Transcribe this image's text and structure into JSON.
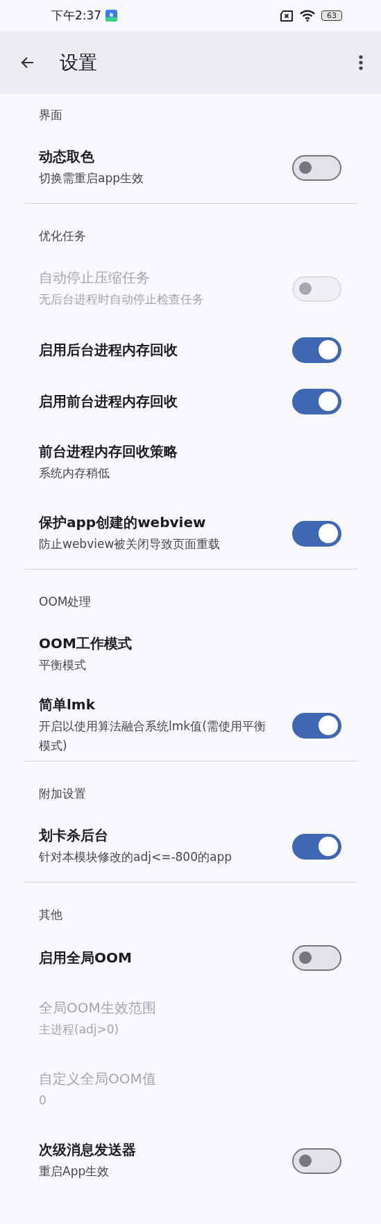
{
  "status_bar": {
    "time": "下午2:37",
    "battery": "63"
  },
  "app_bar": {
    "title": "设置"
  },
  "sections": [
    {
      "title": "界面",
      "items": [
        {
          "kind": "switch",
          "title": "动态取色",
          "subtitle": "切换需重启app生效",
          "on": false,
          "disabled": false
        }
      ]
    },
    {
      "title": "优化任务",
      "items": [
        {
          "kind": "switch",
          "title": "自动停止压缩任务",
          "subtitle": "无后台进程时自动停止检查任务",
          "on": false,
          "disabled": true
        },
        {
          "kind": "switch",
          "title": "启用后台进程内存回收",
          "on": true,
          "disabled": false
        },
        {
          "kind": "switch",
          "title": "启用前台进程内存回收",
          "on": true,
          "disabled": false
        },
        {
          "kind": "choice",
          "title": "前台进程内存回收策略",
          "subtitle": "系统内存稍低",
          "disabled": false
        },
        {
          "kind": "switch",
          "title": "保护app创建的webview",
          "subtitle": "防止webview被关闭导致页面重载",
          "on": true,
          "disabled": false
        }
      ]
    },
    {
      "title": "OOM处理",
      "items": [
        {
          "kind": "choice",
          "title": "OOM工作模式",
          "subtitle": "平衡模式",
          "disabled": false
        },
        {
          "kind": "switch",
          "title": "简单lmk",
          "subtitle": "开启以使用算法融合系统lmk值(需使用平衡模式)",
          "on": true,
          "disabled": false
        }
      ]
    },
    {
      "title": "附加设置",
      "items": [
        {
          "kind": "switch",
          "title": "划卡杀后台",
          "subtitle": "针对本模块修改的adj<=-800的app",
          "on": true,
          "disabled": false
        }
      ]
    },
    {
      "title": "其他",
      "items": [
        {
          "kind": "switch",
          "title": "启用全局OOM",
          "on": false,
          "disabled": false
        },
        {
          "kind": "choice",
          "title": "全局OOM生效范围",
          "subtitle": "主进程(adj>0)",
          "disabled": true
        },
        {
          "kind": "choice",
          "title": "自定义全局OOM值",
          "subtitle": "0",
          "disabled": true
        },
        {
          "kind": "switch",
          "title": "次级消息发送器",
          "subtitle": "重启App生效",
          "on": false,
          "disabled": false
        }
      ]
    }
  ]
}
